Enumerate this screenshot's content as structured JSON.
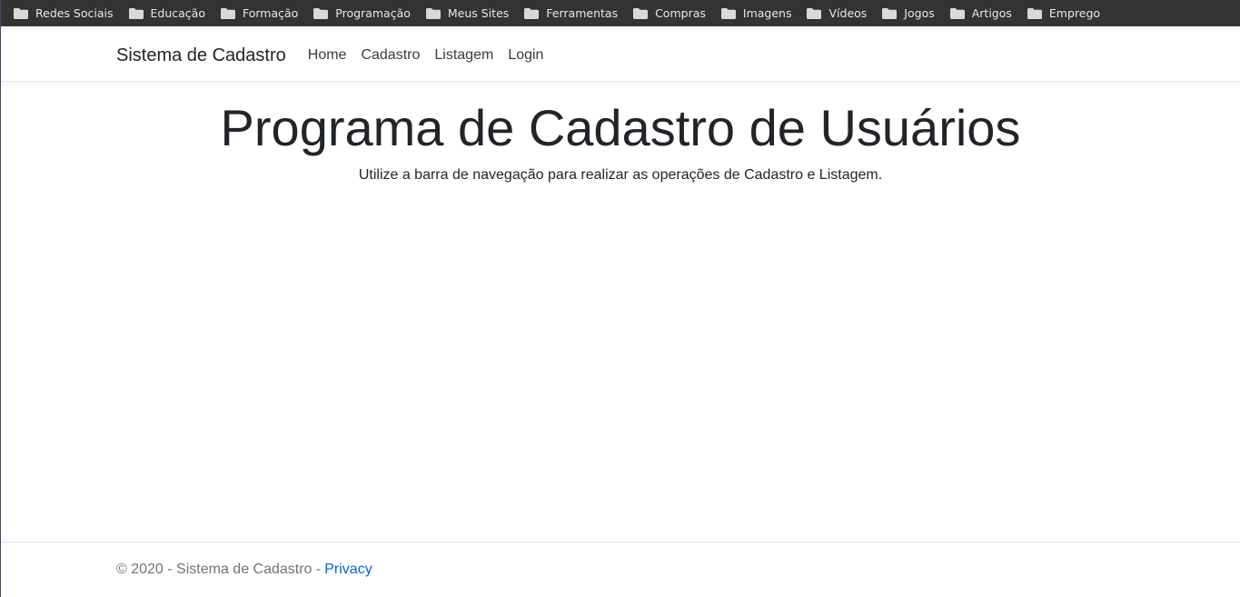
{
  "bookmarks": [
    {
      "label": "Redes Sociais",
      "icon": "folder-icon"
    },
    {
      "label": "Educação",
      "icon": "folder-icon"
    },
    {
      "label": "Formação",
      "icon": "folder-icon"
    },
    {
      "label": "Programação",
      "icon": "folder-icon"
    },
    {
      "label": "Meus Sites",
      "icon": "folder-icon"
    },
    {
      "label": "Ferramentas",
      "icon": "folder-icon"
    },
    {
      "label": "Compras",
      "icon": "folder-icon"
    },
    {
      "label": "Imagens",
      "icon": "folder-icon"
    },
    {
      "label": "Vídeos",
      "icon": "folder-icon"
    },
    {
      "label": "Jogos",
      "icon": "folder-icon"
    },
    {
      "label": "Artigos",
      "icon": "folder-icon"
    },
    {
      "label": "Emprego",
      "icon": "folder-icon"
    }
  ],
  "navbar": {
    "brand": "Sistema de Cadastro",
    "links": [
      "Home",
      "Cadastro",
      "Listagem",
      "Login"
    ]
  },
  "main": {
    "title": "Programa de Cadastro de Usuários",
    "lead": "Utilize a barra de navegação para realizar as operações de Cadastro e Listagem."
  },
  "footer": {
    "text": "© 2020 - Sistema de Cadastro -",
    "link": "Privacy"
  },
  "colors": {
    "bookmarks_bg": "#333333",
    "link": "#0366d6"
  }
}
